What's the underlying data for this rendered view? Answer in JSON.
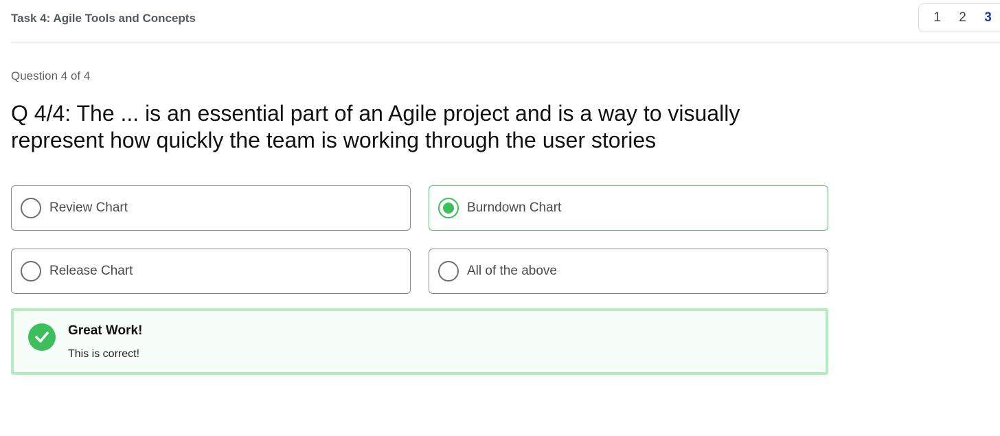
{
  "header": {
    "task_title": "Task 4: Agile Tools and Concepts",
    "pages": [
      "1",
      "2",
      "3"
    ],
    "current_page": "3"
  },
  "question": {
    "counter": "Question 4 of 4",
    "text": "Q 4/4: The ... is an essential part of an Agile project and is a way to visually represent how quickly the team is working through the user stories"
  },
  "options": [
    {
      "label": "Review Chart",
      "selected": false
    },
    {
      "label": "Burndown Chart",
      "selected": true
    },
    {
      "label": "Release Chart",
      "selected": false
    },
    {
      "label": "All of the above",
      "selected": false
    }
  ],
  "feedback": {
    "title": "Great Work!",
    "message": "This is correct!",
    "icon": "check-circle-icon"
  },
  "colors": {
    "success": "#3dbf5c",
    "success_border": "#b3edbf",
    "current_page": "#1c3f9c"
  }
}
